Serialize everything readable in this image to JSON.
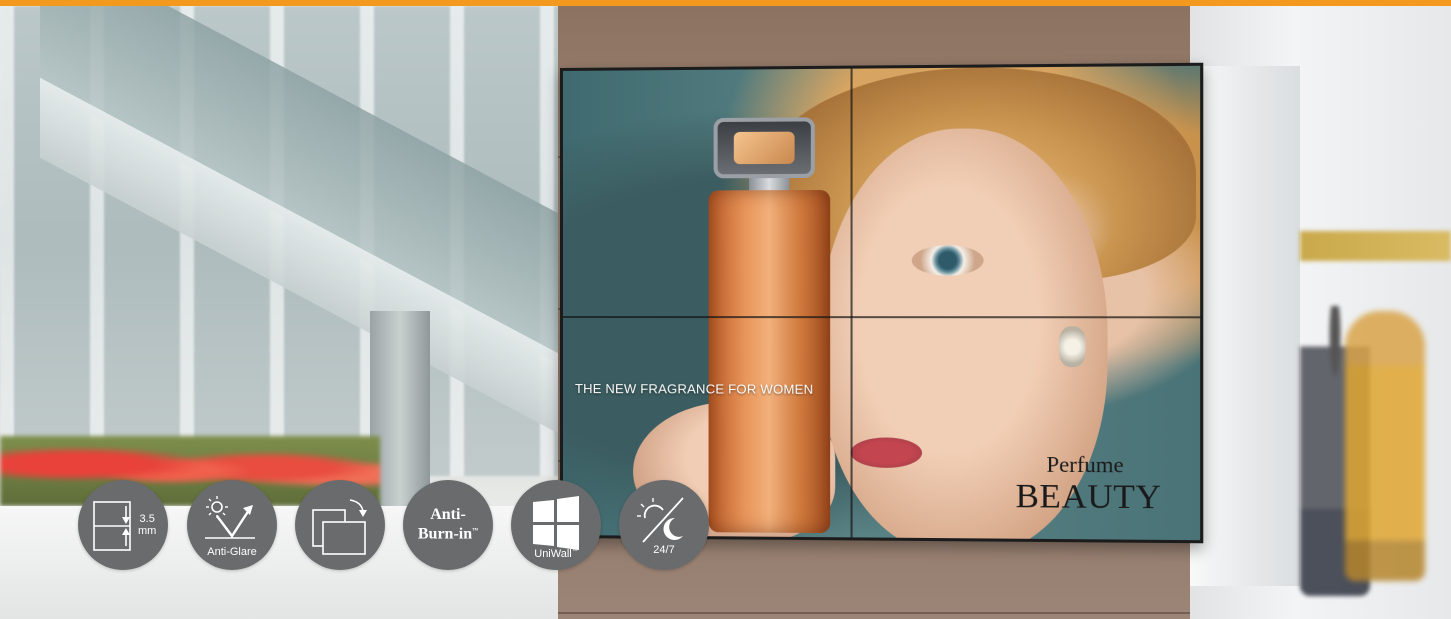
{
  "colors": {
    "accent_bar": "#f39a1e",
    "badge_background": "#6a6b6c",
    "badge_text": "#ffffff"
  },
  "display": {
    "tagline": "THE NEW FRAGRANCE FOR WOMEN",
    "brand_line1": "Perfume",
    "brand_line2": "BEAUTY"
  },
  "features": [
    {
      "name": "narrow-bezel",
      "icon": "bezel-icon",
      "value": "3.5",
      "unit": "mm"
    },
    {
      "name": "anti-glare",
      "icon": "sun-reflection-icon",
      "label": "Anti-Glare"
    },
    {
      "name": "rotation",
      "icon": "rotate-screens-icon"
    },
    {
      "name": "anti-burn-in",
      "line1": "Anti-",
      "line2": "Burn-in",
      "tm": "™"
    },
    {
      "name": "uniwall",
      "icon": "windows-grid-icon",
      "label": "UniWall",
      "tm": "™"
    },
    {
      "name": "24-7",
      "icon": "sun-moon-icon",
      "label": "24/7"
    }
  ]
}
